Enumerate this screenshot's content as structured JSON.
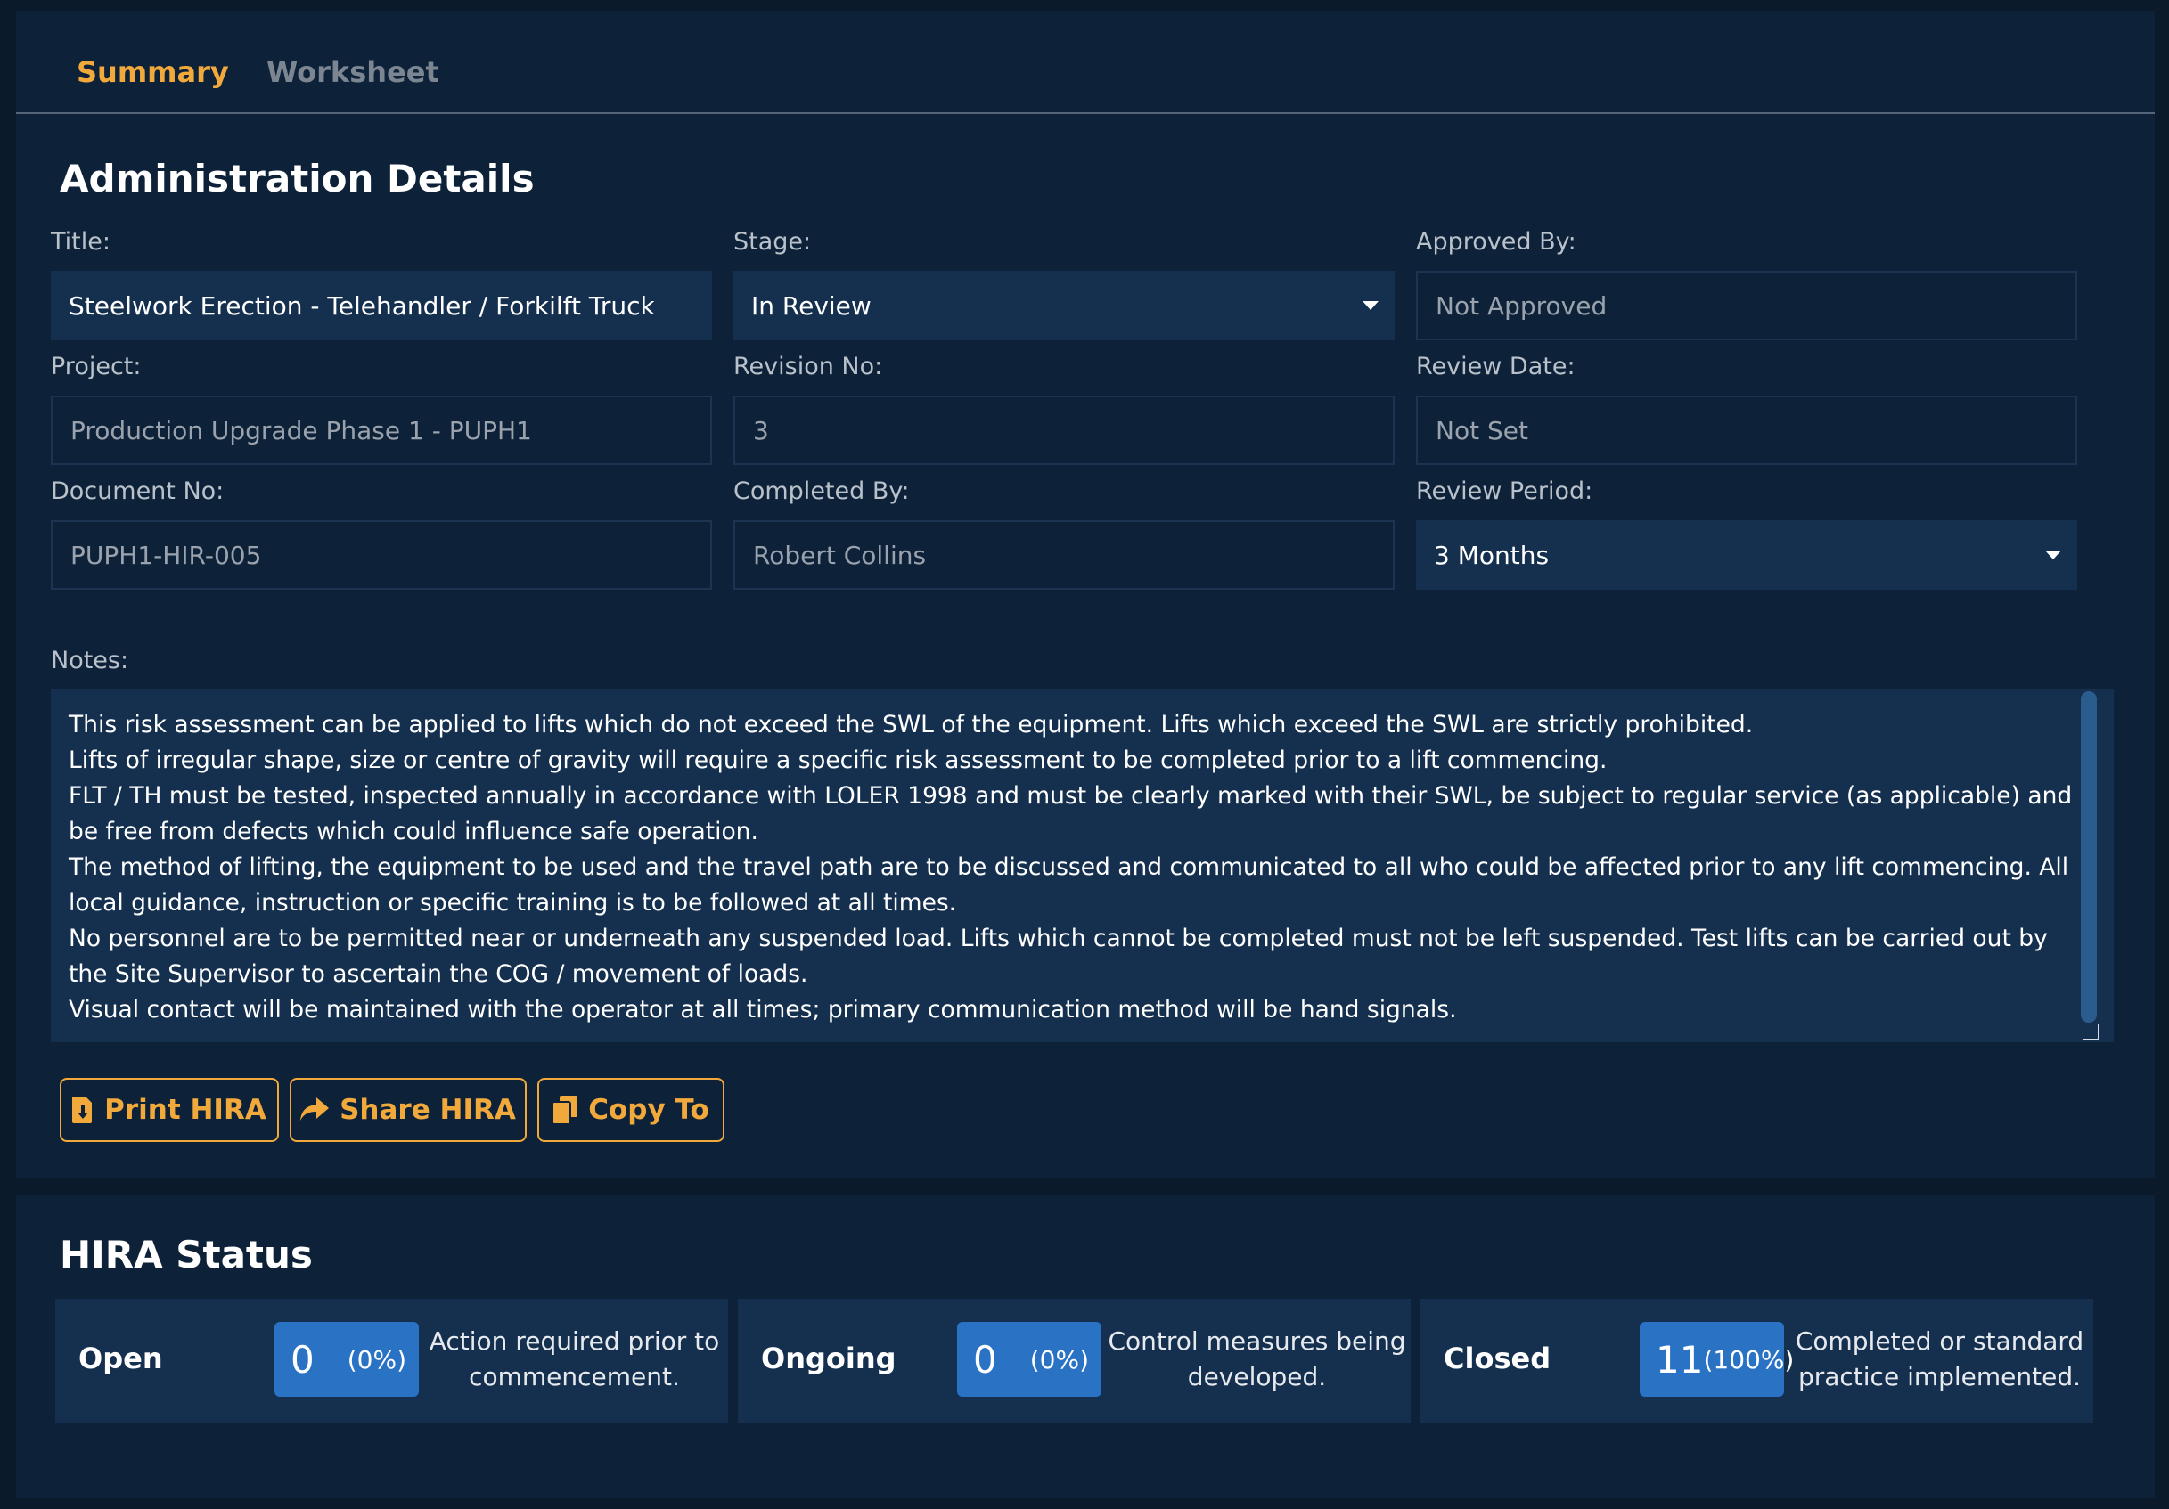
{
  "tabs": [
    {
      "label": "Summary"
    },
    {
      "label": "Worksheet"
    }
  ],
  "admin": {
    "title": "Administration Details",
    "fields": {
      "title": {
        "label": "Title:",
        "value": "Steelwork Erection - Telehandler / Forkilft Truck"
      },
      "stage": {
        "label": "Stage:",
        "value": "In Review"
      },
      "approved_by": {
        "label": "Approved By:",
        "value": "Not Approved"
      },
      "project": {
        "label": "Project:",
        "value": "Production Upgrade Phase 1 - PUPH1"
      },
      "revision_no": {
        "label": "Revision No:",
        "value": "3"
      },
      "review_date": {
        "label": "Review Date:",
        "value": "Not Set"
      },
      "document_no": {
        "label": "Document No:",
        "value": "PUPH1-HIR-005"
      },
      "completed_by": {
        "label": "Completed By:",
        "value": "Robert Collins"
      },
      "review_period": {
        "label": "Review Period:",
        "value": "3 Months"
      }
    },
    "notes": {
      "label": "Notes:",
      "lines": [
        "This risk assessment can be applied to lifts which do not exceed the SWL of the equipment. Lifts which exceed the SWL are strictly prohibited.",
        "Lifts of irregular shape, size or centre of gravity will require a specific risk assessment to be completed prior to a lift commencing.",
        "FLT / TH must be tested, inspected annually in accordance with LOLER 1998 and must be clearly marked with their SWL, be subject to regular service (as applicable) and be free from defects which could influence safe operation.",
        "The method of lifting, the equipment to be used and the travel path are to be discussed and communicated to all who could be affected prior to any lift commencing. All local guidance, instruction or specific training is to be followed at all times.",
        "No personnel are to be permitted near or underneath any suspended load. Lifts which cannot be completed must not be left suspended. Test lifts can be carried out by the Site Supervisor to ascertain the COG / movement of loads.",
        "Visual contact will be maintained with the operator at all times; primary communication method will be hand signals."
      ]
    },
    "buttons": {
      "print": "Print HIRA",
      "share": "Share HIRA",
      "copy": "Copy To"
    }
  },
  "status": {
    "title": "HIRA Status",
    "cards": [
      {
        "name": "Open",
        "count": "0",
        "percent": "(0%)",
        "description": "Action required prior to commencement."
      },
      {
        "name": "Ongoing",
        "count": "0",
        "percent": "(0%)",
        "description": "Control measures being developed."
      },
      {
        "name": "Closed",
        "count": "11",
        "percent": "(100%)",
        "description": "Completed or standard practice implemented."
      }
    ]
  },
  "colors": {
    "accent": "#f2a93b",
    "badge": "#2a72c4",
    "panel": "#0d2138",
    "field": "#15304f"
  }
}
